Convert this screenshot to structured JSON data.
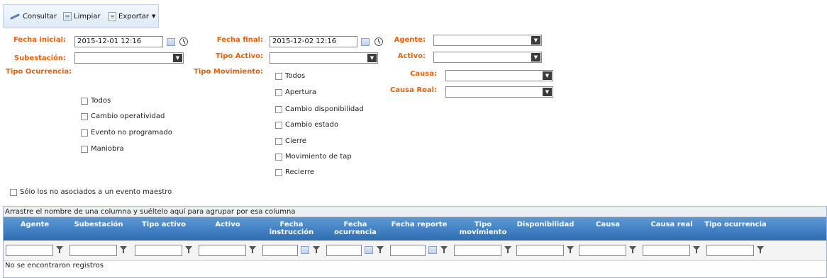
{
  "toolbar": {
    "consultar": "Consultar",
    "limpiar": "Limpiar",
    "exportar": "Exportar"
  },
  "form": {
    "fecha_inicial_label": "Fecha inicial:",
    "fecha_inicial_value": "2015-12-01 12:16",
    "fecha_final_label": "Fecha final:",
    "fecha_final_value": "2015-12-02 12:16",
    "agente_label": "Agente:",
    "subestacion_label": "Subestación:",
    "tipo_activo_label": "Tipo Activo:",
    "activo_label": "Activo:",
    "tipo_ocurrencia_label": "Tipo Ocurrencia:",
    "tipo_movimiento_label": "Tipo Movimiento:",
    "causa_label": "Causa:",
    "causa_real_label": "Causa Real:"
  },
  "tipo_ocurrencia_options": [
    "Todos",
    "Cambio operatividad",
    "Evento no programado",
    "Maniobra"
  ],
  "tipo_movimiento_options": [
    "Todos",
    "Apertura",
    "Cambio disponibilidad",
    "Cambio estado",
    "Cierre",
    "Movimiento de tap",
    "Recierre"
  ],
  "solo_no_asociados": "Sólo los no asociados a un evento maestro",
  "grid": {
    "group_hint": "Arrastre el nombre de una columna y suéltelo aquí para agrupar por esa columna",
    "columns": [
      "Agente",
      "Subestación",
      "Tipo activo",
      "Activo",
      "Fecha\ninstrucción",
      "Fecha\nocurrencia",
      "Fecha reporte",
      "Tipo\nmovimiento",
      "Disponibilidad",
      "Causa",
      "Causa real",
      "Tipo ocurrencia"
    ],
    "empty_message": "No se encontraron registros"
  },
  "colors": {
    "label": "#e4600e",
    "header_top": "#5b9ad6",
    "header_bottom": "#2f6db1"
  }
}
